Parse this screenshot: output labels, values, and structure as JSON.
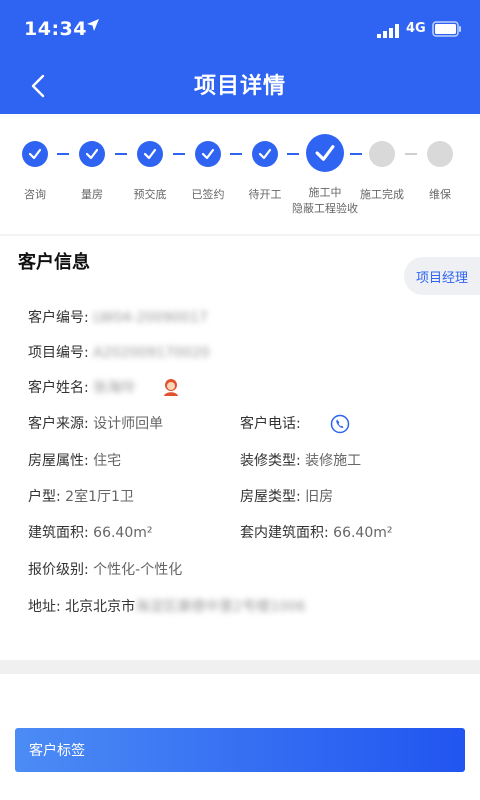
{
  "status_bar": {
    "time": "14:34",
    "network": "4G"
  },
  "header": {
    "title": "项目详情"
  },
  "steps": [
    {
      "label": "咨询",
      "state": "done"
    },
    {
      "label": "量房",
      "state": "done"
    },
    {
      "label": "预交底",
      "state": "done"
    },
    {
      "label": "已签约",
      "state": "done"
    },
    {
      "label": "待开工",
      "state": "done"
    },
    {
      "label": "施工中\n隐蔽工程验收",
      "state": "current"
    },
    {
      "label": "施工完成",
      "state": "todo"
    },
    {
      "label": "维保",
      "state": "todo"
    }
  ],
  "customer": {
    "title": "客户信息",
    "manager_button": "项目经理",
    "customer_no_label": "客户编号:",
    "customer_no_value": "LW04-20090017",
    "project_no_label": "项目编号:",
    "project_no_value": "A202009170020",
    "name_label": "客户姓名:",
    "name_value": "张海玲",
    "source_label": "客户来源:",
    "source_value": "设计师回单",
    "phone_label": "客户电话:",
    "house_attr_label": "房屋属性:",
    "house_attr_value": "住宅",
    "decor_type_label": "装修类型:",
    "decor_type_value": "装修施工",
    "layout_label": "户型:",
    "layout_value": "2室1厅1卫",
    "house_type_label": "房屋类型:",
    "house_type_value": "旧房",
    "area_label": "建筑面积:",
    "area_value": "66.40m²",
    "inner_area_label": "套内建筑面积:",
    "inner_area_value": "66.40m²",
    "quote_label": "报价级别:",
    "quote_value": "个性化-个性化",
    "address_label": "地址:",
    "address_value": "北京北京市",
    "address_blur": "海淀区康德中里2号楼1006"
  },
  "tags": {
    "title": "客户标签"
  },
  "colors": {
    "primary": "#2f64f3",
    "inactive": "#d9d9d9"
  }
}
